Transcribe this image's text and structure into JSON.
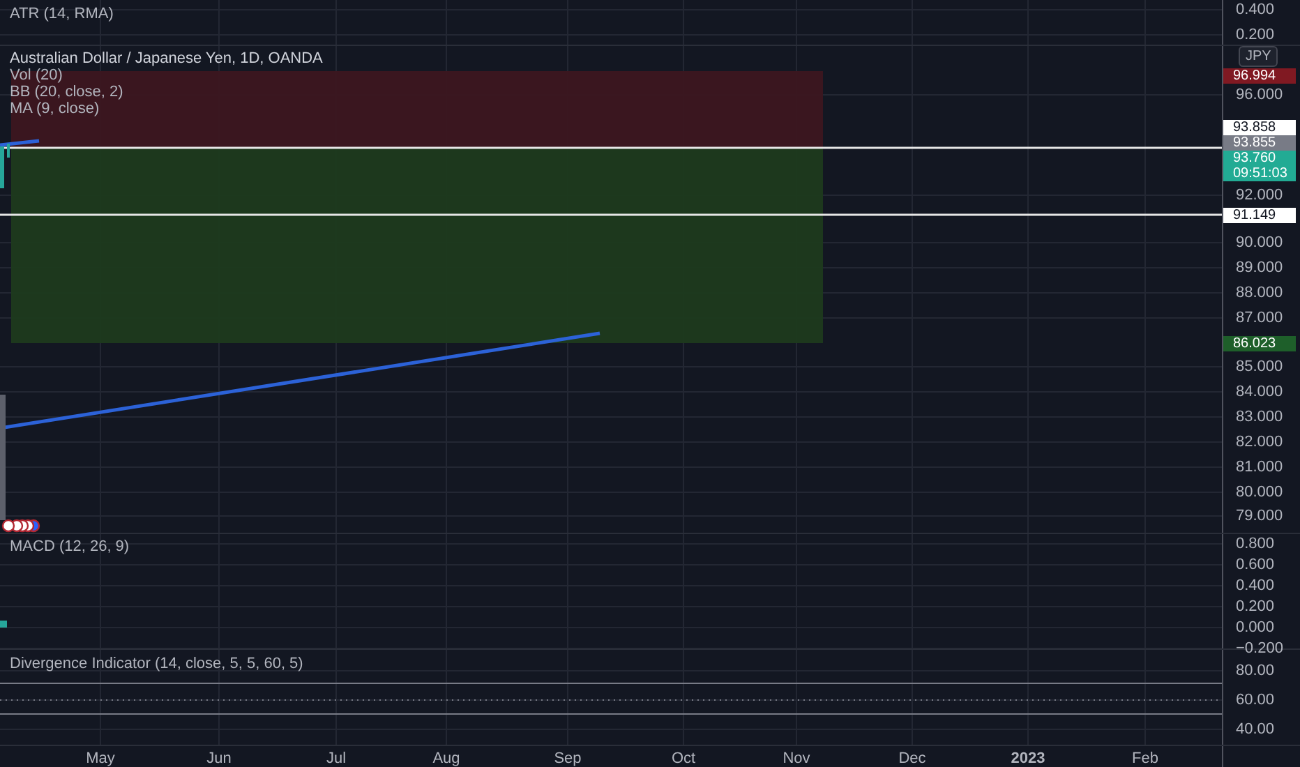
{
  "atr_pane": {
    "title": "ATR (14, RMA)",
    "axis_labels": [
      "0.400",
      "0.200"
    ]
  },
  "main_pane": {
    "title": "Australian Dollar / Japanese Yen, 1D, OANDA",
    "indicators": [
      "Vol (20)",
      "BB (20, close, 2)",
      "MA (9, close)"
    ],
    "currency": "JPY",
    "axis_labels": [
      "96.000",
      "92.000",
      "90.000",
      "89.000",
      "88.000",
      "87.000",
      "85.000",
      "84.000",
      "83.000",
      "82.000",
      "81.000",
      "80.000",
      "79.000"
    ],
    "price_tags": [
      {
        "kind": "stop",
        "text": "96.994"
      },
      {
        "kind": "line",
        "text": "93.858"
      },
      {
        "kind": "previous",
        "text": "93.855"
      },
      {
        "kind": "last",
        "text": "93.760",
        "countdown": "09:51:03"
      },
      {
        "kind": "line",
        "text": "91.149"
      },
      {
        "kind": "target",
        "text": "86.023"
      }
    ]
  },
  "macd_pane": {
    "title": "MACD (12, 26, 9)",
    "axis_labels": [
      "0.800",
      "0.600",
      "0.400",
      "0.200",
      "0.000",
      "−0.200"
    ]
  },
  "divergence_pane": {
    "title": "Divergence Indicator (14, close, 5, 5, 60, 5)",
    "axis_labels": [
      "80.00",
      "60.00",
      "40.00"
    ]
  },
  "time_axis": [
    "May",
    "Jun",
    "Jul",
    "Aug",
    "Sep",
    "Oct",
    "Nov",
    "Dec",
    "2023",
    "Feb"
  ]
}
